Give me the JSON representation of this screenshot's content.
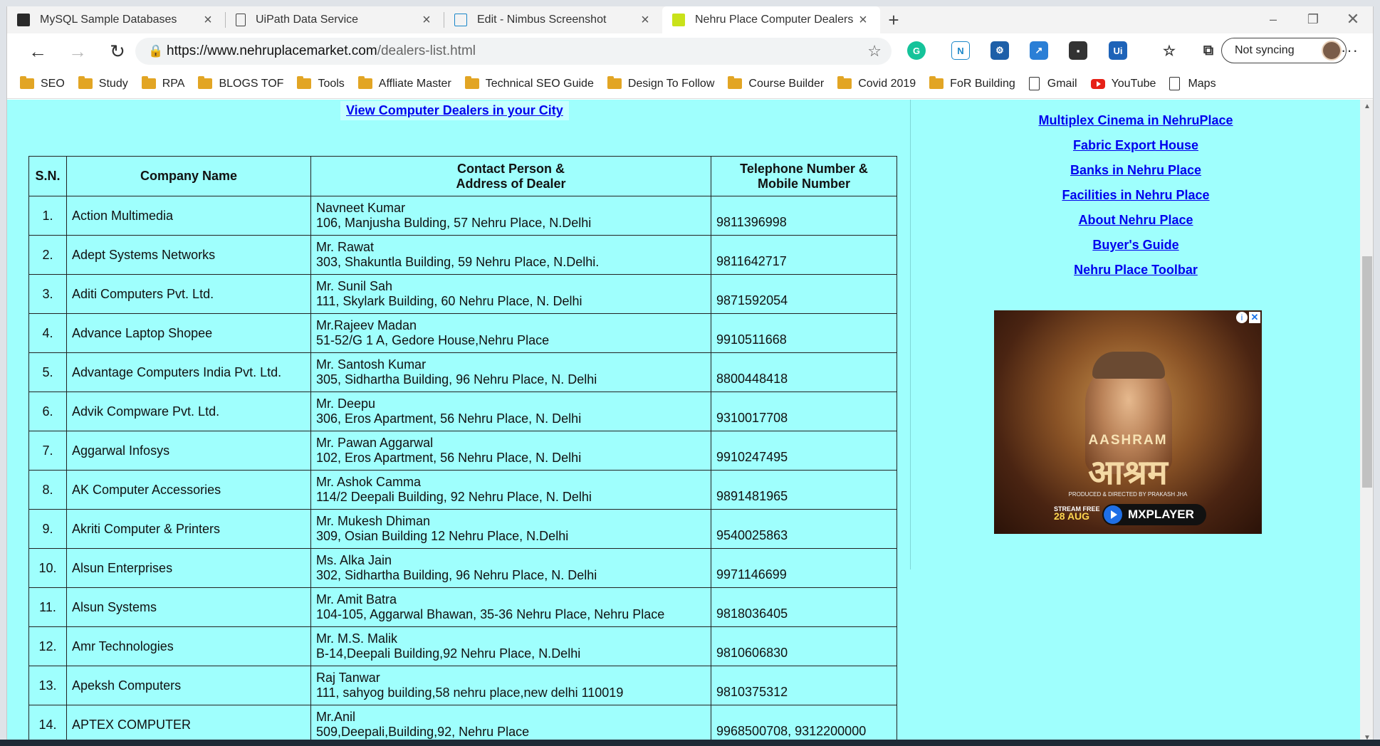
{
  "browser": {
    "tabs": [
      {
        "title": "MySQL Sample Databases",
        "favicon_color": "#2a2a2a"
      },
      {
        "title": "UiPath Data Service",
        "favicon_color": "#ffffff"
      },
      {
        "title": "Edit - Nimbus Screenshot",
        "favicon_color": "#1a87c9"
      },
      {
        "title": "Nehru Place Computer Dealers S",
        "favicon_color": "#c9e21a"
      }
    ],
    "active_tab_index": 3,
    "url_host": "https://www.nehruplacemarket.com",
    "url_path": "/dealers-list.html",
    "profile_label": "Not syncing",
    "bookmarks": [
      {
        "label": "SEO",
        "icon": "folder-icon"
      },
      {
        "label": "Study",
        "icon": "folder-icon"
      },
      {
        "label": "RPA",
        "icon": "folder-icon"
      },
      {
        "label": "BLOGS TOF",
        "icon": "folder-icon"
      },
      {
        "label": "Tools",
        "icon": "folder-icon"
      },
      {
        "label": "Affliate Master",
        "icon": "folder-icon"
      },
      {
        "label": "Technical SEO Guide",
        "icon": "folder-icon"
      },
      {
        "label": "Design To Follow",
        "icon": "folder-icon"
      },
      {
        "label": "Course Builder",
        "icon": "folder-icon"
      },
      {
        "label": "Covid 2019",
        "icon": "folder-icon"
      },
      {
        "label": "FoR Building",
        "icon": "folder-icon"
      },
      {
        "label": "Gmail",
        "icon": "page-icon"
      },
      {
        "label": "YouTube",
        "icon": "youtube-icon"
      },
      {
        "label": "Maps",
        "icon": "page-icon"
      }
    ]
  },
  "page": {
    "city_link": "View Computer Dealers in your City",
    "table": {
      "headers": {
        "sn": "S.N.",
        "company": "Company Name",
        "contact_line1": "Contact Person &",
        "contact_line2": "Address of Dealer",
        "phone_line1": "Telephone Number &",
        "phone_line2": "Mobile Number"
      },
      "rows": [
        {
          "sn": "1.",
          "company": "Action Multimedia",
          "person": "Navneet Kumar",
          "address": "106, Manjusha Bulding, 57 Nehru Place, N.Delhi",
          "phone": "9811396998"
        },
        {
          "sn": "2.",
          "company": "Adept Systems Networks",
          "person": "Mr. Rawat",
          "address": "303, Shakuntla Building, 59 Nehru Place, N.Delhi.",
          "phone": "9811642717"
        },
        {
          "sn": "3.",
          "company": "Aditi Computers Pvt. Ltd.",
          "person": "Mr. Sunil Sah",
          "address": "111, Skylark Building, 60 Nehru Place, N. Delhi",
          "phone": "9871592054"
        },
        {
          "sn": "4.",
          "company": "Advance Laptop Shopee",
          "person": "Mr.Rajeev Madan",
          "address": "51-52/G 1 A, Gedore House,Nehru Place",
          "phone": "9910511668"
        },
        {
          "sn": "5.",
          "company": "Advantage Computers India Pvt. Ltd.",
          "person": "Mr. Santosh Kumar",
          "address": "305, Sidhartha Building, 96 Nehru Place, N. Delhi",
          "phone": "8800448418"
        },
        {
          "sn": "6.",
          "company": "Advik Compware Pvt. Ltd.",
          "person": "Mr. Deepu",
          "address": "306, Eros Apartment, 56 Nehru Place, N. Delhi",
          "phone": "9310017708"
        },
        {
          "sn": "7.",
          "company": "Aggarwal Infosys",
          "person": "Mr. Pawan Aggarwal",
          "address": "102, Eros Apartment, 56 Nehru Place, N. Delhi",
          "phone": "9910247495"
        },
        {
          "sn": "8.",
          "company": "AK Computer Accessories",
          "person": "Mr. Ashok Camma",
          "address": "114/2 Deepali Building, 92 Nehru Place, N. Delhi",
          "phone": "9891481965"
        },
        {
          "sn": "9.",
          "company": "Akriti Computer & Printers",
          "person": "Mr. Mukesh Dhiman",
          "address": "309, Osian Building 12 Nehru Place, N.Delhi",
          "phone": "9540025863"
        },
        {
          "sn": "10.",
          "company": "Alsun Enterprises",
          "person": "Ms. Alka Jain",
          "address": "302, Sidhartha Building, 96 Nehru Place, N. Delhi",
          "phone": "9971146699"
        },
        {
          "sn": "11.",
          "company": "Alsun Systems",
          "person": "Mr. Amit Batra",
          "address": "104-105, Aggarwal Bhawan, 35-36 Nehru Place, Nehru Place",
          "phone": "9818036405"
        },
        {
          "sn": "12.",
          "company": "Amr Technologies",
          "person": "Mr. M.S. Malik",
          "address": "B-14,Deepali Building,92 Nehru Place, N.Delhi",
          "phone": "9810606830"
        },
        {
          "sn": "13.",
          "company": "Apeksh Computers",
          "person": "Raj Tanwar",
          "address": "111, sahyog building,58 nehru place,new delhi 110019",
          "phone": "9810375312"
        },
        {
          "sn": "14.",
          "company": "APTEX COMPUTER",
          "person": "Mr.Anil",
          "address": "509,Deepali,Building,92, Nehru Place",
          "phone": "9968500708, 9312200000"
        }
      ]
    },
    "side_links": [
      "Multiplex Cinema in NehruPlace",
      "Fabric Export House",
      "Banks in Nehru Place",
      "Facilities in Nehru Place",
      "About Nehru Place",
      "Buyer's Guide",
      "Nehru Place Toolbar"
    ],
    "ad": {
      "title_en": "AASHRAM",
      "title_hi": "आश्रम",
      "produced_by": "PRODUCED & DIRECTED BY PRAKASH JHA",
      "stream_line1": "STREAM FREE",
      "stream_date": "28 AUG",
      "brand": "MXPLAYER"
    }
  },
  "colors": {
    "page_bg": "#9ffffd",
    "link": "#0000ee"
  }
}
